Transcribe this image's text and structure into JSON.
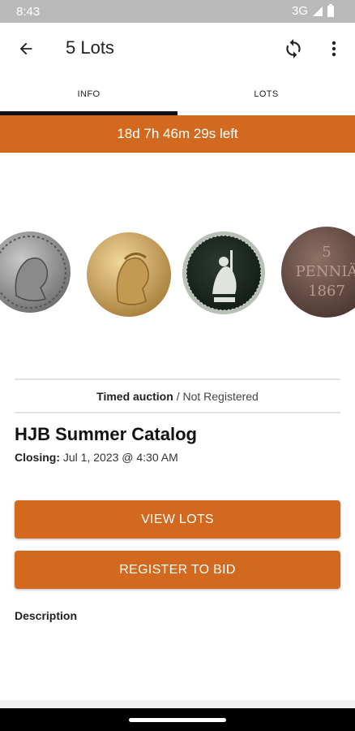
{
  "status_bar": {
    "time": "8:43",
    "network": "3G"
  },
  "app_bar": {
    "title": "5 Lots"
  },
  "tabs": [
    {
      "label": "INFO",
      "selected": true
    },
    {
      "label": "LOTS",
      "selected": false
    }
  ],
  "countdown": {
    "text": "18d 7h 46m 29s left"
  },
  "coins": [
    {
      "name": "silver-roman-bust-coin",
      "color": "#9a9a9a"
    },
    {
      "name": "gold-bust-coin",
      "color": "#c8a562"
    },
    {
      "name": "seated-liberty-coin",
      "color": "#8c9a8a"
    },
    {
      "name": "penni-coin",
      "color": "#6e5448"
    }
  ],
  "auction": {
    "type": "Timed auction",
    "separator": "/",
    "status": "Not Registered"
  },
  "catalog": {
    "title": "HJB Summer Catalog",
    "closing_label": "Closing:",
    "closing_value": "Jul 1, 2023 @ 4:30 AM"
  },
  "buttons": {
    "view_lots": "VIEW LOTS",
    "register": "REGISTER TO BID"
  },
  "description_label": "Description",
  "colors": {
    "accent": "#d2691e",
    "status_bar": "#b9b9b9"
  }
}
